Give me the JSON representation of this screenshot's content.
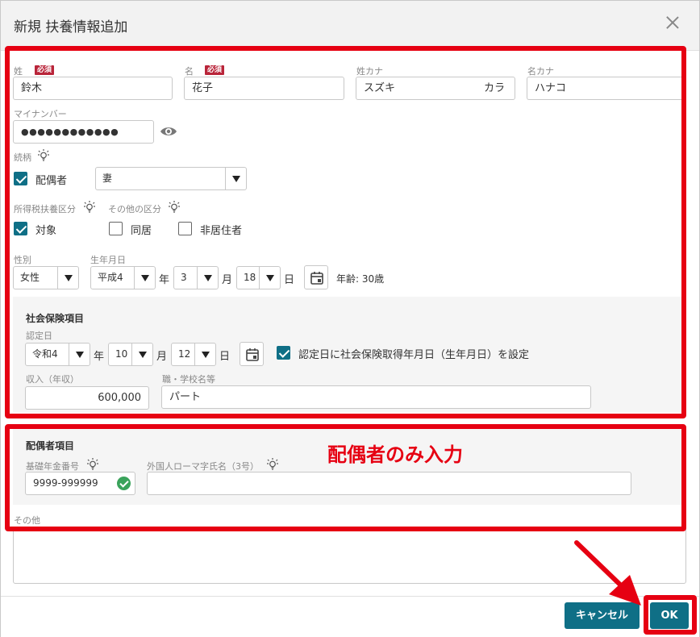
{
  "dialog": {
    "title": "新規 扶養情報追加"
  },
  "name": {
    "last_label": "姓",
    "first_label": "名",
    "required_badge": "必須",
    "last_value": "鈴木",
    "first_value": "花子",
    "last_kana_label": "姓カナ",
    "first_kana_label": "名カナ",
    "last_kana_value": "スズキ",
    "last_kana_overflow": "カラ",
    "first_kana_value": "ハナコ"
  },
  "mynumber": {
    "label": "マイナンバー",
    "masked_value": "●●●●●●●●●●●●"
  },
  "relation": {
    "label": "続柄",
    "spouse_label": "配偶者",
    "spouse_checked": true,
    "select_value": "妻"
  },
  "tax": {
    "label": "所得税扶養区分",
    "other_label": "その他の区分",
    "target_label": "対象",
    "target_checked": true,
    "cohabit_label": "同居",
    "nonresident_label": "非居住者"
  },
  "gender": {
    "label": "性別",
    "value": "女性"
  },
  "birth": {
    "label": "生年月日",
    "era": "平成4",
    "year_unit": "年",
    "month": "3",
    "month_unit": "月",
    "day": "18",
    "day_unit": "日",
    "age_text": "年齢: 30歳"
  },
  "social": {
    "title": "社会保険項目",
    "cert_label": "認定日",
    "era": "令和4",
    "year_unit": "年",
    "month": "10",
    "month_unit": "月",
    "day": "12",
    "day_unit": "日",
    "set_label": "認定日に社会保険取得年月日（生年月日）を設定",
    "set_checked": true,
    "income_label": "収入（年収）",
    "income_value": "600,000",
    "job_label": "職・学校名等",
    "job_value": "パート"
  },
  "spouse_section": {
    "title": "配偶者項目",
    "pension_label": "基礎年金番号",
    "pension_value": "9999-999999",
    "roman_label": "外国人ローマ字氏名（3号）",
    "roman_value": ""
  },
  "other": {
    "label": "その他"
  },
  "footer": {
    "cancel_label": "キャンセル",
    "ok_label": "OK"
  },
  "annotation": {
    "text": "配偶者のみ入力",
    "color": "#e60012"
  },
  "colors": {
    "accent": "#0f6f86",
    "required": "#b9253a",
    "annotation": "#e60012"
  }
}
